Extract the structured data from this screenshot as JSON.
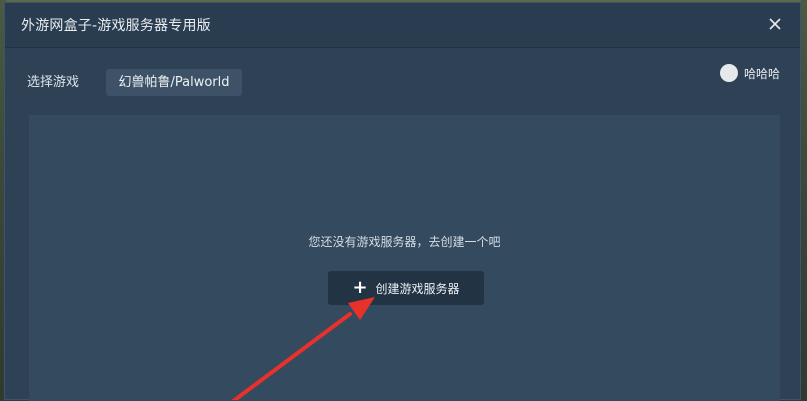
{
  "window": {
    "title": "外游网盒子-游戏服务器专用版"
  },
  "toolbar": {
    "select_label": "选择游戏",
    "selected_game": "幻兽帕鲁/Palworld"
  },
  "user": {
    "name": "哈哈哈"
  },
  "main": {
    "empty_message": "您还没有游戏服务器，去创建一个吧",
    "create_button_label": "创建游戏服务器"
  },
  "icons": {
    "close": "close-icon",
    "create": "plus-icon",
    "annotation": "red-arrow"
  },
  "colors": {
    "window_bg": "#2e4155",
    "content_bg": "#344a5f",
    "button_bg": "#223343",
    "annotation_arrow": "#e8312a"
  }
}
